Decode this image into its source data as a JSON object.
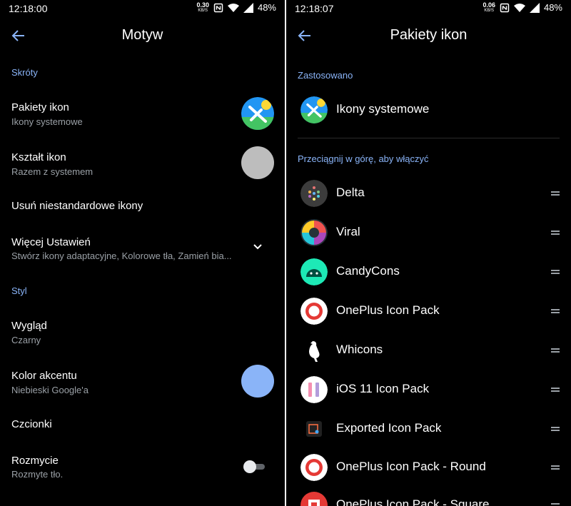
{
  "left": {
    "status": {
      "time": "12:18:00",
      "speed": "0.30",
      "speed_unit": "KB/S",
      "battery": "48%"
    },
    "title": "Motyw",
    "section_shortcuts": "Skróty",
    "icon_packs": {
      "title": "Pakiety ikon",
      "subtitle": "Ikony systemowe"
    },
    "icon_shape": {
      "title": "Kształt ikon",
      "subtitle": "Razem z systemem"
    },
    "remove_custom": {
      "title": "Usuń niestandardowe ikony"
    },
    "more_settings": {
      "title": "Więcej Ustawień",
      "subtitle": "Stwórz ikony adaptacyjne, Kolorowe tła, Zamień bia..."
    },
    "section_style": "Styl",
    "appearance": {
      "title": "Wygląd",
      "subtitle": "Czarny"
    },
    "accent": {
      "title": "Kolor akcentu",
      "subtitle": "Niebieski Google'a",
      "color": "#8ab4f8"
    },
    "fonts": {
      "title": "Czcionki"
    },
    "blur": {
      "title": "Rozmycie",
      "subtitle": "Rozmyte tło.",
      "enabled": false
    }
  },
  "right": {
    "status": {
      "time": "12:18:07",
      "speed": "0.06",
      "speed_unit": "KB/S",
      "battery": "48%"
    },
    "title": "Pakiety ikon",
    "section_applied": "Zastosowano",
    "applied": "Ikony systemowe",
    "section_drag": "Przeciągnij w górę, aby włączyć",
    "packs": [
      {
        "name": "Delta"
      },
      {
        "name": "Viral"
      },
      {
        "name": "CandyCons"
      },
      {
        "name": "OnePlus Icon Pack"
      },
      {
        "name": "Whicons"
      },
      {
        "name": "iOS 11 Icon Pack"
      },
      {
        "name": "Exported Icon Pack"
      },
      {
        "name": "OnePlus Icon Pack - Round"
      },
      {
        "name": "OnePlus Icon Pack - Square"
      }
    ]
  },
  "colors": {
    "accent_text": "#8ab4f8",
    "background": "#000000",
    "secondary_text": "#9aa0a6"
  }
}
